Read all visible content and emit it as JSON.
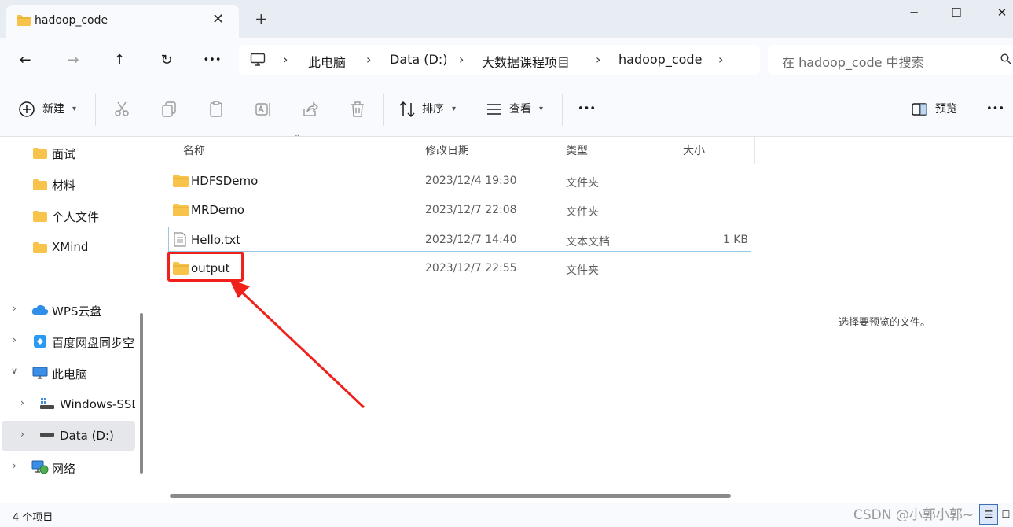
{
  "window": {
    "tab_title": "hadoop_code",
    "tab_close": "✕",
    "new_tab": "+",
    "minimize": "─",
    "maximize": "☐",
    "close": "✕"
  },
  "nav": {
    "back": "←",
    "forward": "→",
    "up": "↑",
    "refresh": "↻",
    "more": "•••"
  },
  "breadcrumb": [
    "此电脑",
    "Data (D:)",
    "大数据课程项目",
    "hadoop_code"
  ],
  "search": {
    "placeholder": "在 hadoop_code 中搜索"
  },
  "toolbar": {
    "new_label": "新建",
    "sort_label": "排序",
    "view_label": "查看",
    "more": "•••",
    "preview_label": "预览"
  },
  "sidebar": {
    "quick_items": [
      "面试",
      "材料",
      "个人文件",
      "XMind"
    ],
    "tree_items": [
      {
        "label": "WPS云盘",
        "icon": "cloud-icon"
      },
      {
        "label": "百度网盘同步空",
        "icon": "baidu-netdisk-icon"
      },
      {
        "label": "此电脑",
        "icon": "computer-icon"
      },
      {
        "label": "Windows-SSD",
        "icon": "drive-icon"
      },
      {
        "label": "Data (D:)",
        "icon": "drive-icon"
      },
      {
        "label": "网络",
        "icon": "network-icon"
      }
    ]
  },
  "columns": {
    "name": "名称",
    "modified": "修改日期",
    "type": "类型",
    "size": "大小"
  },
  "files": [
    {
      "name": "HDFSDemo",
      "modified": "2023/12/4 19:30",
      "type": "文件夹",
      "size": "",
      "icon": "folder-icon"
    },
    {
      "name": "MRDemo",
      "modified": "2023/12/7 22:08",
      "type": "文件夹",
      "size": "",
      "icon": "folder-icon"
    },
    {
      "name": "Hello.txt",
      "modified": "2023/12/7 14:40",
      "type": "文本文档",
      "size": "1 KB",
      "icon": "text-file-icon"
    },
    {
      "name": "output",
      "modified": "2023/12/7 22:55",
      "type": "文件夹",
      "size": "",
      "icon": "folder-icon"
    }
  ],
  "preview": {
    "message": "选择要预览的文件。"
  },
  "status": {
    "count": "4 个项目"
  },
  "watermark": "CSDN @小郭小郭~",
  "colors": {
    "annotation": "#f0201b",
    "folder": "#f7c34a",
    "selection_border": "#99c8e6"
  }
}
